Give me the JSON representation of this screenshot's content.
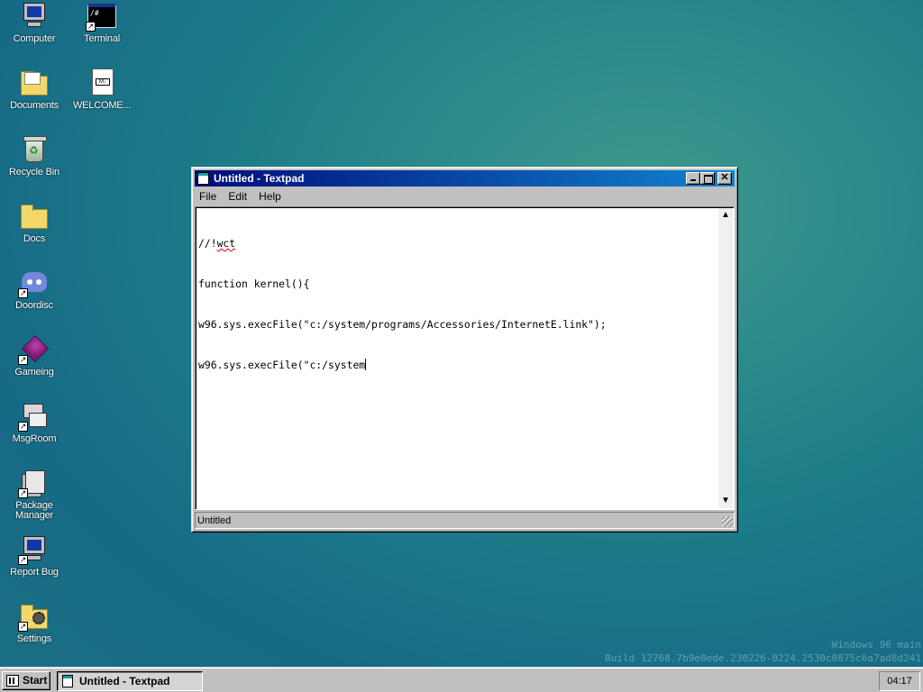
{
  "desktop": {
    "icons": [
      {
        "label": "Computer",
        "icon": "computer-icon"
      },
      {
        "label": "Terminal",
        "icon": "terminal-icon",
        "terminal_text": "/#"
      },
      {
        "label": "Documents",
        "icon": "documents-folder-icon"
      },
      {
        "label": "WELCOME...",
        "icon": "markdown-file-icon",
        "file_badge": "M↓"
      },
      {
        "label": "Recycle Bin",
        "icon": "recycle-bin-icon"
      },
      {
        "label": "Docs",
        "icon": "folder-icon"
      },
      {
        "label": "Doordisc",
        "icon": "discord-icon"
      },
      {
        "label": "Gameing",
        "icon": "game-cube-icon"
      },
      {
        "label": "MsgRoom",
        "icon": "msgroom-icon"
      },
      {
        "label": "Package Manager",
        "icon": "package-manager-icon"
      },
      {
        "label": "Report Bug",
        "icon": "report-bug-icon"
      },
      {
        "label": "Settings",
        "icon": "settings-icon"
      }
    ],
    "shortcut_arrow": "↗"
  },
  "window": {
    "title": "Untitled - Textpad",
    "menu": [
      "File",
      "Edit",
      "Help"
    ],
    "editor_lines": [
      "//!wct",
      "function kernel(){",
      "w96.sys.execFile(\"c:/system/programs/Accessories/InternetE.link\");",
      "w96.sys.execFile(\"c:/system"
    ],
    "editor_line1_prefix": "//!",
    "editor_line1_flagged": "wct",
    "status": "Untitled",
    "scroll_up": "▲",
    "scroll_down": "▼",
    "close_glyph": "✕"
  },
  "watermark": {
    "line1": "Windows 96 main",
    "line2": "Build 12768.7b9e0ede.230226-0224.2530c0875c6a7ad8d241"
  },
  "taskbar": {
    "start_label": "Start",
    "task_label": "Untitled - Textpad",
    "clock": "04:17"
  },
  "colors": {
    "desktop": "#1d7d88",
    "titlebar_start": "#000d7a",
    "titlebar_end": "#1084d0",
    "chrome": "#c0c0c0"
  }
}
